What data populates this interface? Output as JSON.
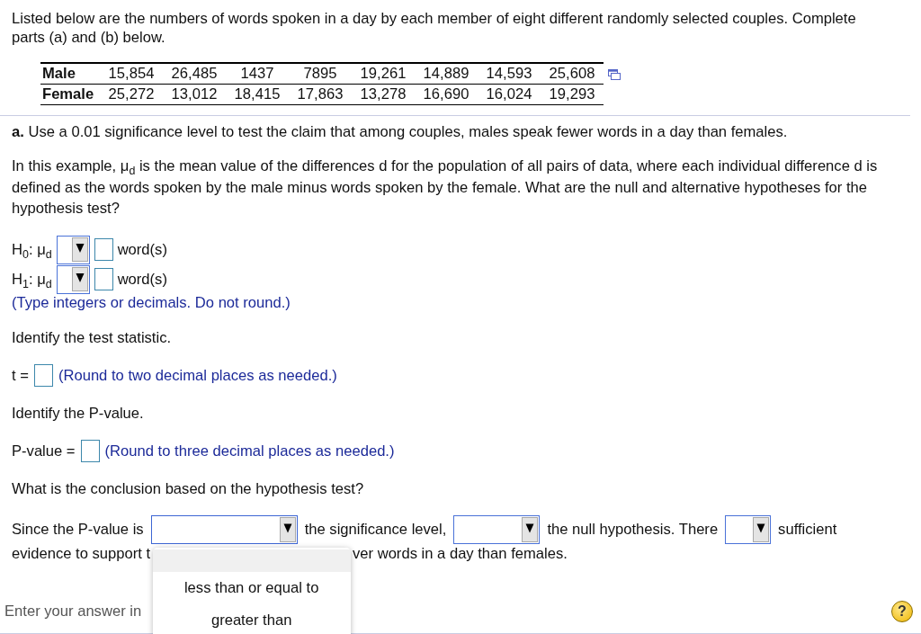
{
  "intro": "Listed below are the numbers of words spoken in a day by each member of eight different randomly selected couples. Complete parts (a) and (b) below.",
  "data_table": {
    "rows": [
      {
        "label": "Male",
        "values": [
          "15,854",
          "26,485",
          "1437",
          "7895",
          "19,261",
          "14,889",
          "14,593",
          "25,608"
        ]
      },
      {
        "label": "Female",
        "values": [
          "25,272",
          "13,012",
          "18,415",
          "17,863",
          "13,278",
          "16,690",
          "16,024",
          "19,293"
        ]
      }
    ]
  },
  "part_a": {
    "prompt": "**a.** Use a 0.01 significance level to test the claim that among couples, males speak fewer words in a day than females.",
    "context": "In this example, μ$_{d}$ is the mean value of the differences d for the population of all pairs of data, where each individual difference d is defined as the words spoken by the male minus words spoken by the female. What are the null and alternative hypotheses for the hypothesis test?",
    "hypotheses": [
      {
        "label": "H$_{0}$: μ$_{d}$",
        "unit": "word(s)"
      },
      {
        "label": "H$_{1}$: μ$_{d}$",
        "unit": "word(s)"
      }
    ],
    "hypotheses_hint": "(Type integers or decimals. Do not round.)",
    "steps": [
      {
        "kind": "instruction",
        "text": "Identify the test statistic."
      },
      {
        "kind": "answer",
        "label": "t =",
        "hint": "(Round to two decimal places as needed.)"
      },
      {
        "kind": "instruction",
        "text": "Identify the P-value."
      },
      {
        "kind": "answer",
        "label": "P-value =",
        "hint": "(Round to three decimal places as needed.)"
      },
      {
        "kind": "instruction",
        "text": "What is the conclusion based on the hypothesis test?"
      }
    ],
    "conclusion": {
      "parts": [
        {
          "kind": "text",
          "text": "Since the P-value is"
        },
        {
          "kind": "dropdown",
          "open": true,
          "options": [
            {
              "selected": true
            },
            {
              "label": "less than or equal to",
              "selected": false
            },
            {
              "label": "greater than",
              "selected": false
            }
          ]
        },
        {
          "kind": "text",
          "text": "the significance level,"
        },
        {
          "kind": "dropdown",
          "open": false
        },
        {
          "kind": "text",
          "text": "the null hypothesis. There"
        },
        {
          "kind": "dropdown",
          "open": false
        },
        {
          "kind": "text",
          "text": "sufficient"
        }
      ],
      "visible_fragments": [
        "evidence to support t",
        "ver words in a day than females."
      ]
    }
  },
  "footer": {
    "instruction": "Enter your answer in",
    "help": "?"
  }
}
